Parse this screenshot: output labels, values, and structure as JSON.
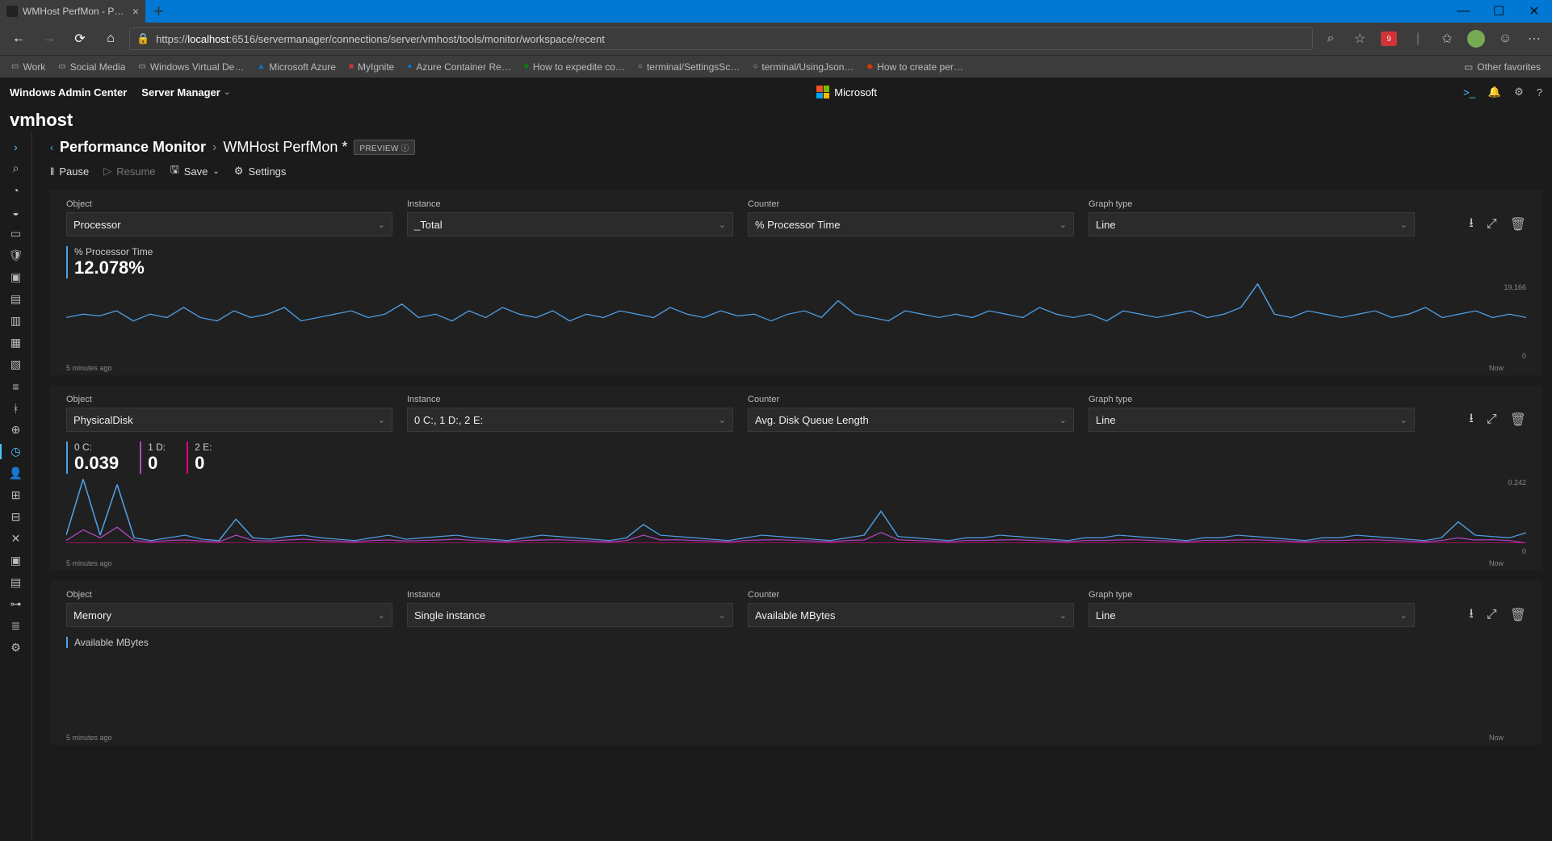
{
  "browser": {
    "tab_title": "WMHost PerfMon - Performanc…",
    "url_prefix": "https://",
    "url_host": "localhost",
    "url_path": ":6516/servermanager/connections/server/vmhost/tools/monitor/workspace/recent",
    "other_fav": "Other favorites",
    "bookmarks": [
      "Work",
      "Social Media",
      "Windows Virtual De…",
      "Microsoft Azure",
      "MyIgnite",
      "Azure Container Re…",
      "How to expedite co…",
      "terminal/SettingsSc…",
      "terminal/UsingJson…",
      "How to create per…"
    ]
  },
  "wac": {
    "brand": "Windows Admin Center",
    "server_menu": "Server Manager",
    "microsoft": "Microsoft",
    "host": "vmhost"
  },
  "crumb": {
    "root": "Performance Monitor",
    "leaf": "WMHost PerfMon *",
    "preview": "PREVIEW ⓘ"
  },
  "cmd": {
    "pause": "Pause",
    "resume": "Resume",
    "save": "Save",
    "settings": "Settings"
  },
  "labels": {
    "object": "Object",
    "instance": "Instance",
    "counter": "Counter",
    "graph": "Graph type"
  },
  "time": {
    "left": "5 minutes ago",
    "right": "Now"
  },
  "panels": [
    {
      "object": "Processor",
      "instance": "_Total",
      "counter": "% Processor Time",
      "graph": "Line",
      "ymax": "19.166",
      "ymin": "0",
      "metrics": [
        {
          "label": "% Processor Time",
          "value": "12.078%",
          "color": "#4f9fe6"
        }
      ]
    },
    {
      "object": "PhysicalDisk",
      "instance": "0 C:, 1 D:, 2 E:",
      "counter": "Avg. Disk Queue Length",
      "graph": "Line",
      "ymax": "0.242",
      "ymin": "0",
      "metrics": [
        {
          "label": "0 C:",
          "value": "0.039",
          "color": "#4f9fe6"
        },
        {
          "label": "1 D:",
          "value": "0",
          "color": "#b146c2"
        },
        {
          "label": "2 E:",
          "value": "0",
          "color": "#e3008c"
        }
      ]
    },
    {
      "object": "Memory",
      "instance": "Single instance",
      "counter": "Available MBytes",
      "graph": "Line",
      "ymax": "",
      "ymin": "",
      "metrics": [
        {
          "label": "Available MBytes",
          "value": "",
          "color": "#4f9fe6"
        }
      ]
    }
  ],
  "chart_data": [
    {
      "type": "line",
      "title": "% Processor Time",
      "xlabel": "",
      "ylabel": "",
      "xlim": [
        "5 minutes ago",
        "Now"
      ],
      "ylim": [
        0,
        19.166
      ],
      "series": [
        {
          "name": "_Total",
          "color": "#4f9fe6",
          "values": [
            9,
            10,
            9.5,
            11,
            8,
            10,
            9,
            12,
            9,
            8,
            11,
            9,
            10,
            12,
            8,
            9,
            10,
            11,
            9,
            10,
            13,
            9,
            10,
            8,
            11,
            9,
            12,
            10,
            9,
            11,
            8,
            10,
            9,
            11,
            10,
            9,
            12,
            10,
            9,
            11,
            9.5,
            10,
            8,
            10,
            11,
            9,
            14,
            10,
            9,
            8,
            11,
            10,
            9,
            10,
            9,
            11,
            10,
            9,
            12,
            10,
            9,
            10,
            8,
            11,
            10,
            9,
            10,
            11,
            9,
            10,
            12,
            19,
            10,
            9,
            11,
            10,
            9,
            10,
            11,
            9,
            10,
            12,
            9,
            10,
            11,
            9,
            10,
            9
          ]
        }
      ]
    },
    {
      "type": "line",
      "title": "Avg. Disk Queue Length",
      "xlabel": "",
      "ylabel": "",
      "xlim": [
        "5 minutes ago",
        "Now"
      ],
      "ylim": [
        0,
        0.242
      ],
      "series": [
        {
          "name": "0 C:",
          "color": "#4f9fe6",
          "values": [
            0.03,
            0.24,
            0.03,
            0.22,
            0.02,
            0.01,
            0.02,
            0.03,
            0.015,
            0.01,
            0.09,
            0.02,
            0.015,
            0.025,
            0.03,
            0.02,
            0.015,
            0.01,
            0.02,
            0.03,
            0.015,
            0.02,
            0.025,
            0.03,
            0.02,
            0.015,
            0.01,
            0.02,
            0.03,
            0.025,
            0.02,
            0.015,
            0.01,
            0.02,
            0.07,
            0.03,
            0.025,
            0.02,
            0.015,
            0.01,
            0.02,
            0.03,
            0.025,
            0.02,
            0.015,
            0.01,
            0.02,
            0.03,
            0.12,
            0.025,
            0.02,
            0.015,
            0.01,
            0.02,
            0.02,
            0.03,
            0.025,
            0.02,
            0.015,
            0.01,
            0.02,
            0.02,
            0.03,
            0.025,
            0.02,
            0.015,
            0.01,
            0.02,
            0.02,
            0.03,
            0.025,
            0.02,
            0.015,
            0.01,
            0.02,
            0.02,
            0.03,
            0.025,
            0.02,
            0.015,
            0.01,
            0.02,
            0.08,
            0.03,
            0.025,
            0.02,
            0.039
          ]
        },
        {
          "name": "1 D:",
          "color": "#b146c2",
          "values": [
            0.01,
            0.05,
            0.02,
            0.06,
            0.01,
            0.005,
            0.01,
            0.012,
            0.008,
            0.005,
            0.03,
            0.01,
            0.008,
            0.012,
            0.015,
            0.01,
            0.008,
            0.005,
            0.01,
            0.012,
            0.008,
            0.01,
            0.012,
            0.015,
            0.01,
            0.008,
            0.005,
            0.01,
            0.012,
            0.013,
            0.01,
            0.008,
            0.005,
            0.01,
            0.03,
            0.012,
            0.013,
            0.01,
            0.008,
            0.005,
            0.01,
            0.012,
            0.013,
            0.01,
            0.008,
            0.005,
            0.01,
            0.012,
            0.04,
            0.013,
            0.01,
            0.008,
            0.005,
            0.01,
            0.01,
            0.012,
            0.013,
            0.01,
            0.008,
            0.005,
            0.01,
            0.01,
            0.012,
            0.013,
            0.01,
            0.008,
            0.005,
            0.01,
            0.01,
            0.012,
            0.013,
            0.01,
            0.008,
            0.005,
            0.01,
            0.01,
            0.012,
            0.013,
            0.01,
            0.008,
            0.005,
            0.01,
            0.02,
            0.012,
            0.013,
            0.01,
            0
          ]
        },
        {
          "name": "2 E:",
          "color": "#e3008c",
          "values": [
            0,
            0,
            0,
            0,
            0,
            0,
            0,
            0,
            0,
            0,
            0,
            0,
            0,
            0,
            0,
            0,
            0,
            0,
            0,
            0,
            0,
            0,
            0,
            0,
            0,
            0,
            0,
            0,
            0,
            0,
            0,
            0,
            0,
            0,
            0,
            0,
            0,
            0,
            0,
            0,
            0,
            0,
            0,
            0,
            0,
            0,
            0,
            0,
            0,
            0,
            0,
            0,
            0,
            0,
            0,
            0,
            0,
            0,
            0,
            0,
            0,
            0,
            0,
            0,
            0,
            0,
            0,
            0,
            0,
            0,
            0,
            0,
            0,
            0,
            0,
            0,
            0,
            0,
            0,
            0,
            0,
            0,
            0,
            0,
            0,
            0,
            0
          ]
        }
      ]
    }
  ]
}
